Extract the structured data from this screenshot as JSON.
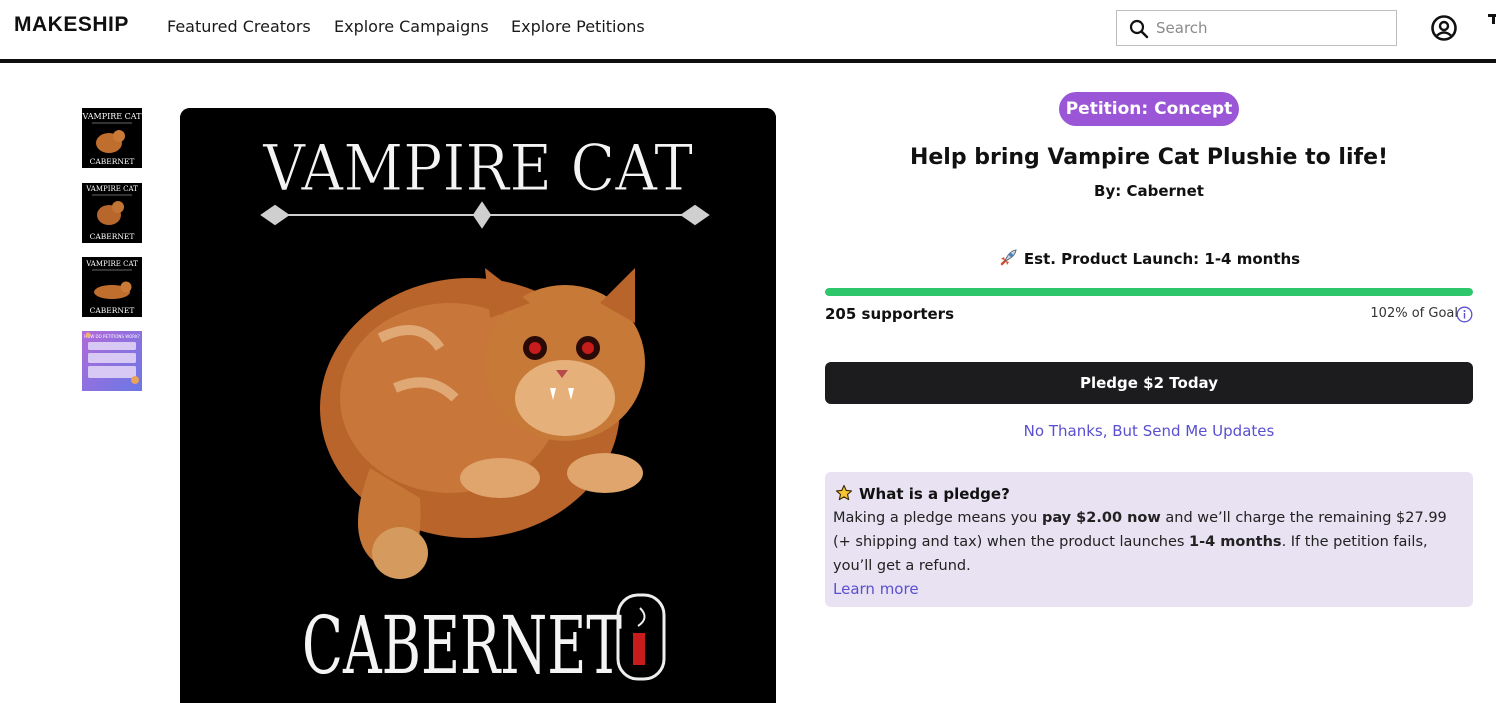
{
  "header": {
    "logo": "MAKESHIP",
    "nav": [
      "Featured Creators",
      "Explore Campaigns",
      "Explore Petitions"
    ],
    "search_placeholder": "Search",
    "icons": {
      "search": "search-icon",
      "account": "account-icon"
    }
  },
  "gallery": {
    "thumbnails": [
      {
        "kind": "cat-sitting",
        "caption_top": "VAMPIRE CAT",
        "caption_bottom": "CABERNET"
      },
      {
        "kind": "cat-side",
        "caption_top": "VAMPIRE CAT",
        "caption_bottom": "CABERNET"
      },
      {
        "kind": "cat-lying",
        "caption_top": "VAMPIRE CAT",
        "caption_bottom": "CABERNET"
      },
      {
        "kind": "info-card",
        "caption_top": "HOW DO PETITIONS WORK?",
        "caption_bottom": ""
      }
    ],
    "main_image": {
      "title": "VAMPIRE CAT",
      "subtitle": "CABERNET"
    }
  },
  "campaign": {
    "badge": "Petition: Concept",
    "badge_color": "#9a56d6",
    "title": "Help bring Vampire Cat Plushie to life!",
    "byline": "By: Cabernet",
    "launch_label": "Est. Product Launch: 1-4 months",
    "supporters_count": "205",
    "supporters_label": "supporters",
    "goal_percent": "102%",
    "goal_label": "of Goal",
    "progress_fraction": 1.0,
    "progress_color": "#2ec66a",
    "pledge_button": "Pledge $2 Today",
    "updates_link": "No Thanks, But Send Me Updates"
  },
  "pledge_info": {
    "title": "What is a pledge?",
    "body_1": "Making a pledge means you ",
    "body_bold_1": "pay $2.00 now",
    "body_2": " and we’ll charge the remaining $27.99 (+ shipping and tax) when the product launches ",
    "body_bold_2": "1-4 months",
    "body_3": ". If the petition fails, you’ll get a refund.",
    "learn_more": "Learn more"
  }
}
